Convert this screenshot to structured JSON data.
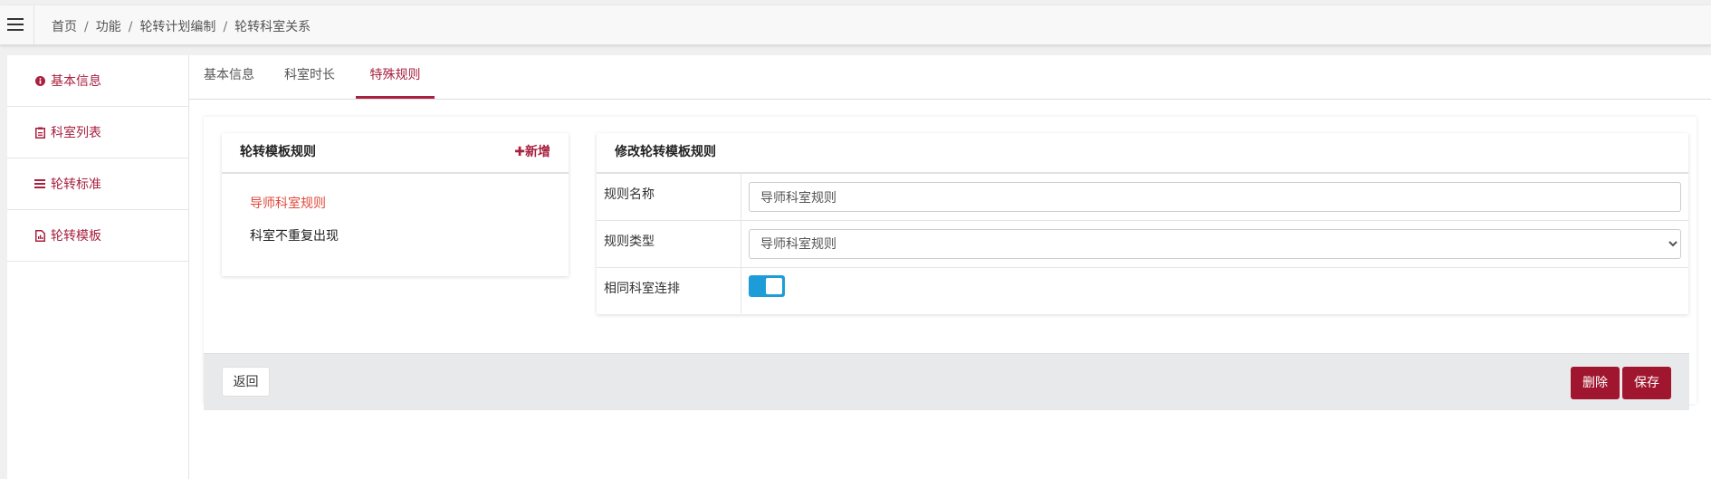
{
  "breadcrumb": [
    "首页",
    "功能",
    "轮转计划编制",
    "轮转科室关系"
  ],
  "sidebar": {
    "items": [
      {
        "label": "基本信息",
        "icon": "info-circle-icon"
      },
      {
        "label": "科室列表",
        "icon": "clipboard-icon"
      },
      {
        "label": "轮转标准",
        "icon": "list-icon"
      },
      {
        "label": "轮转模板",
        "icon": "file-icon"
      }
    ]
  },
  "tabs": [
    {
      "label": "基本信息",
      "active": false
    },
    {
      "label": "科室时长",
      "active": false
    },
    {
      "label": "特殊规则",
      "active": true
    }
  ],
  "rules_card": {
    "title": "轮转模板规则",
    "add_label": "✚新增",
    "items": [
      {
        "label": "导师科室规则",
        "selected": true
      },
      {
        "label": "科室不重复出现",
        "selected": false
      }
    ]
  },
  "edit_card": {
    "title": "修改轮转模板规则",
    "name_label": "规则名称",
    "name_value": "导师科室规则",
    "type_label": "规则类型",
    "type_value": "导师科室规则",
    "consecutive_label": "相同科室连排",
    "consecutive_on": true
  },
  "footer": {
    "back_label": "返回",
    "delete_label": "删除",
    "save_label": "保存"
  },
  "colors": {
    "accent": "#a8213f",
    "danger_button": "#a1162f",
    "toggle_on": "#1e9cd7",
    "selected_rule": "#e0493a"
  }
}
